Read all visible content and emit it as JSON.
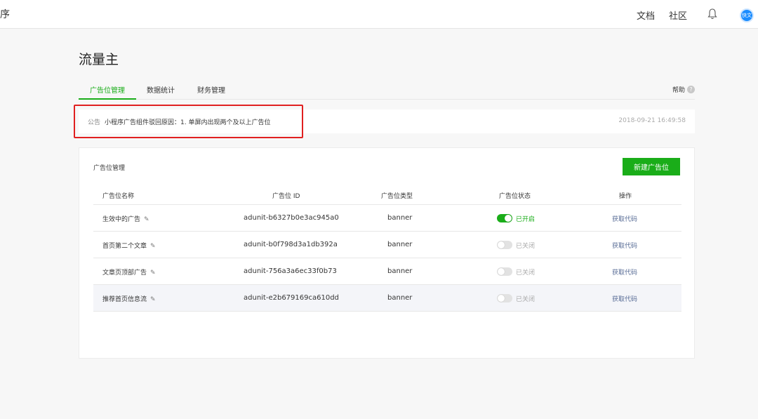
{
  "topbar": {
    "app_title_fragment": "序",
    "links": [
      "文档",
      "社区"
    ],
    "avatar_text": "快文"
  },
  "page_title": "流量主",
  "tabs": [
    {
      "label": "广告位管理",
      "active": true
    },
    {
      "label": "数据统计",
      "active": false
    },
    {
      "label": "财务管理",
      "active": false
    }
  ],
  "help_label": "帮助",
  "notice": {
    "label": "公告",
    "text": "小程序广告组件驳回原因：1. 单屏内出现两个及以上广告位",
    "time": "2018-09-21 16:49:58"
  },
  "card": {
    "title": "广告位管理",
    "new_button": "新建广告位",
    "columns": [
      "广告位名称",
      "广告位 ID",
      "广告位类型",
      "广告位状态",
      "操作"
    ],
    "rows": [
      {
        "name": "生效中的广告",
        "id": "adunit-b6327b0e3ac945a0",
        "type": "banner",
        "status": "已开启",
        "on": true,
        "action": "获取代码"
      },
      {
        "name": "首页第二个文章",
        "id": "adunit-b0f798d3a1db392a",
        "type": "banner",
        "status": "已关闭",
        "on": false,
        "action": "获取代码"
      },
      {
        "name": "文章页顶部广告",
        "id": "adunit-756a3a6ec33f0b73",
        "type": "banner",
        "status": "已关闭",
        "on": false,
        "action": "获取代码"
      },
      {
        "name": "推荐首页信息流",
        "id": "adunit-e2b679169ca610dd",
        "type": "banner",
        "status": "已关闭",
        "on": false,
        "action": "获取代码"
      }
    ]
  },
  "colors": {
    "accent_green": "#1aad19",
    "link_blue": "#576b95",
    "highlight_red": "#e02020"
  }
}
